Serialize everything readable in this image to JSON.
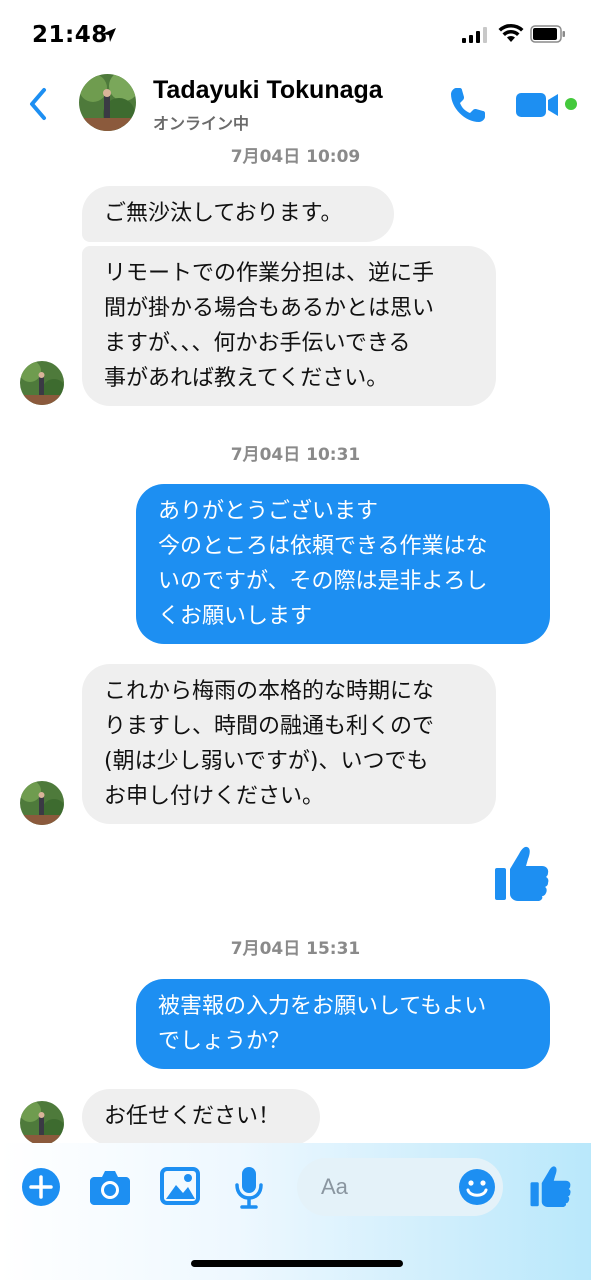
{
  "status_bar": {
    "time": "21:48"
  },
  "header": {
    "contact_name": "Tadayuki Tokunaga",
    "contact_status": "オンライン中"
  },
  "messages": [
    {
      "type": "timestamp",
      "text": "7月04日 10:09"
    },
    {
      "type": "incoming",
      "text": "ご無沙汰しております。"
    },
    {
      "type": "incoming",
      "text": "リモートでの作業分担は、逆に手\n間が掛かる場合もあるかとは思い\nますが、、、何かお手伝いできる\n事があれば教えてください。"
    },
    {
      "type": "timestamp",
      "text": "7月04日 10:31"
    },
    {
      "type": "outgoing",
      "text": "ありがとうございます\n今のところは依頼できる作業はな\nいのですが、その際は是非よろし\nくお願いします"
    },
    {
      "type": "incoming",
      "text": "これから梅雨の本格的な時期にな\nりますし、時間の融通も利くので\n(朝は少し弱いですが)、いつでも\nお申し付けください。"
    },
    {
      "type": "outgoing-like",
      "icon": "thumbs-up-icon"
    },
    {
      "type": "timestamp",
      "text": "7月04日 15:31"
    },
    {
      "type": "outgoing",
      "text": "被害報の入力をお願いしてもよい\nでしょうか？"
    },
    {
      "type": "incoming",
      "text": "お任せください！"
    }
  ],
  "composer": {
    "placeholder": "Aa",
    "icons": [
      "plus-icon",
      "camera-icon",
      "image-icon",
      "microphone-icon",
      "emoji-icon",
      "thumbs-up-icon"
    ]
  },
  "colors": {
    "accent": "#1d8ff2",
    "incoming_bubble": "#efefef",
    "online": "#44c93c"
  }
}
